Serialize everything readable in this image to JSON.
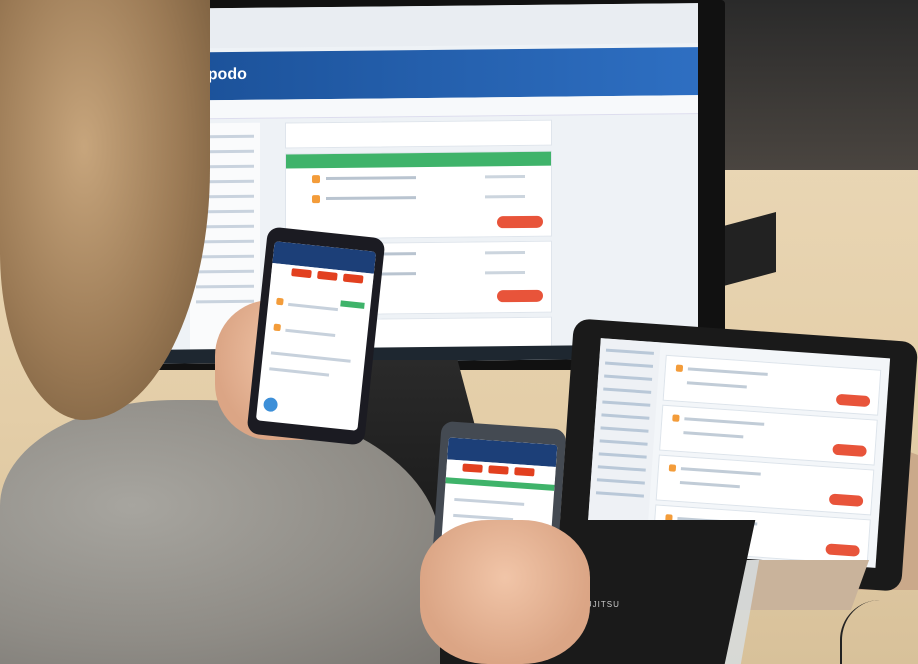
{
  "scene": {
    "description_labels": {
      "monitor_brand": "opodo",
      "keyboard_brand": "FUJITSU"
    }
  },
  "colors": {
    "brand_blue": "#1a4f96",
    "accent_red": "#e8543a",
    "success_green": "#3fb36a",
    "icon_orange": "#f39c3a"
  }
}
